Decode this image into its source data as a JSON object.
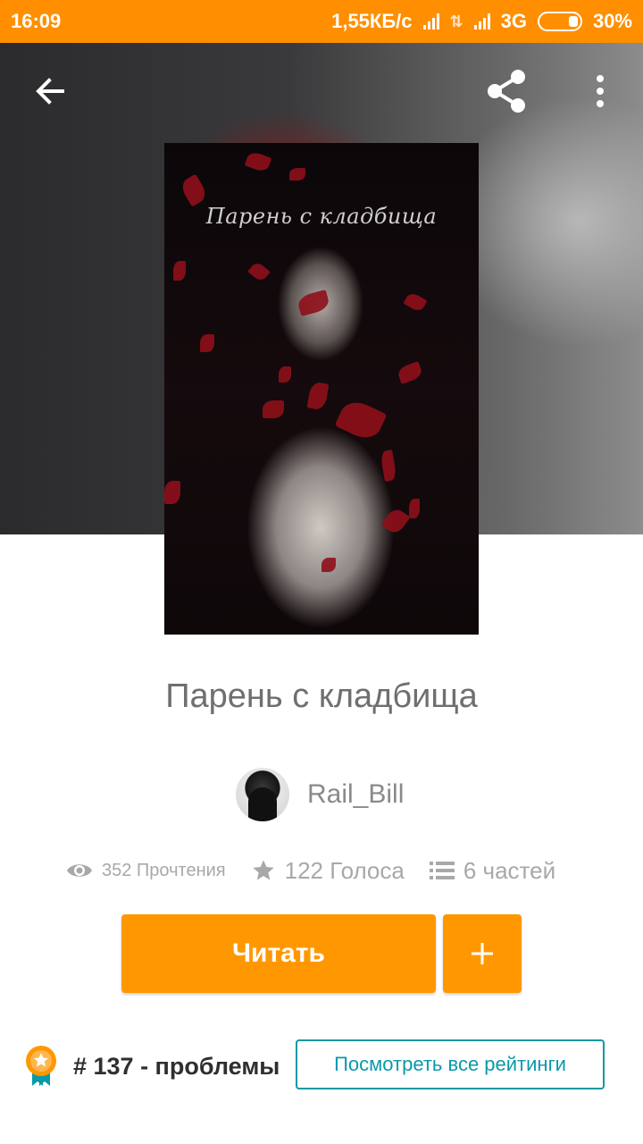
{
  "status_bar": {
    "time": "16:09",
    "speed": "1,55КБ/с",
    "network": "3G",
    "battery": "30%"
  },
  "header": {
    "back_icon": "arrow-left-icon",
    "share_icon": "share-icon",
    "more_icon": "more-vertical-icon"
  },
  "cover": {
    "title": "Парень с кладбища"
  },
  "story": {
    "title": "Парень с кладбища",
    "author": "Rail_Bill",
    "reads": "352 Прочтения",
    "votes": "122 Голоса",
    "parts": "6 частей"
  },
  "actions": {
    "read_label": "Читать",
    "add_icon": "plus-icon"
  },
  "ranking": {
    "text": "# 137 - проблемы",
    "view_all_label": "Посмотреть все рейтинги"
  },
  "colors": {
    "accent": "#ff9800",
    "status_bar": "#ff8f00",
    "teal": "#0a99a8"
  }
}
